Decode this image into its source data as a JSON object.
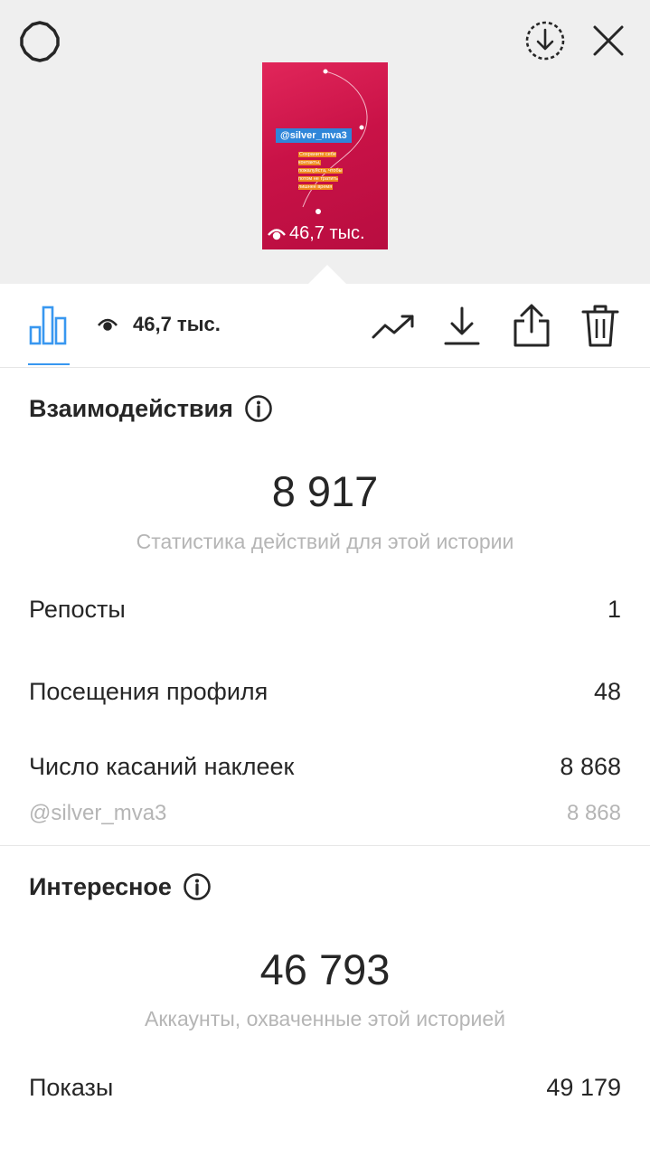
{
  "header": {
    "settings_icon": "gear-icon",
    "download_icon": "download-circle-icon",
    "close_icon": "close-icon"
  },
  "story": {
    "tag": "@silver_mva3",
    "note": "Сохраните себе контакты, пожалуйста, чтобы потом не тратить лишнее время",
    "views": "46,7 тыс."
  },
  "toolbar": {
    "views": "46,7 тыс."
  },
  "interactions": {
    "title": "Взаимодействия",
    "total": "8 917",
    "caption": "Статистика действий для этой истории",
    "rows": [
      {
        "label": "Репосты",
        "value": "1"
      },
      {
        "label": "Посещения профиля",
        "value": "48"
      },
      {
        "label": "Число касаний наклеек",
        "value": "8 868"
      }
    ],
    "sub": {
      "label": "@silver_mva3",
      "value": "8 868"
    }
  },
  "discovery": {
    "title": "Интересное",
    "total": "46 793",
    "caption": "Аккаунты, охваченные этой историей",
    "rows": [
      {
        "label": "Показы",
        "value": "49 179"
      }
    ]
  },
  "colors": {
    "accent": "#3897f0",
    "muted": "#b5b5b5",
    "text": "#262626"
  }
}
